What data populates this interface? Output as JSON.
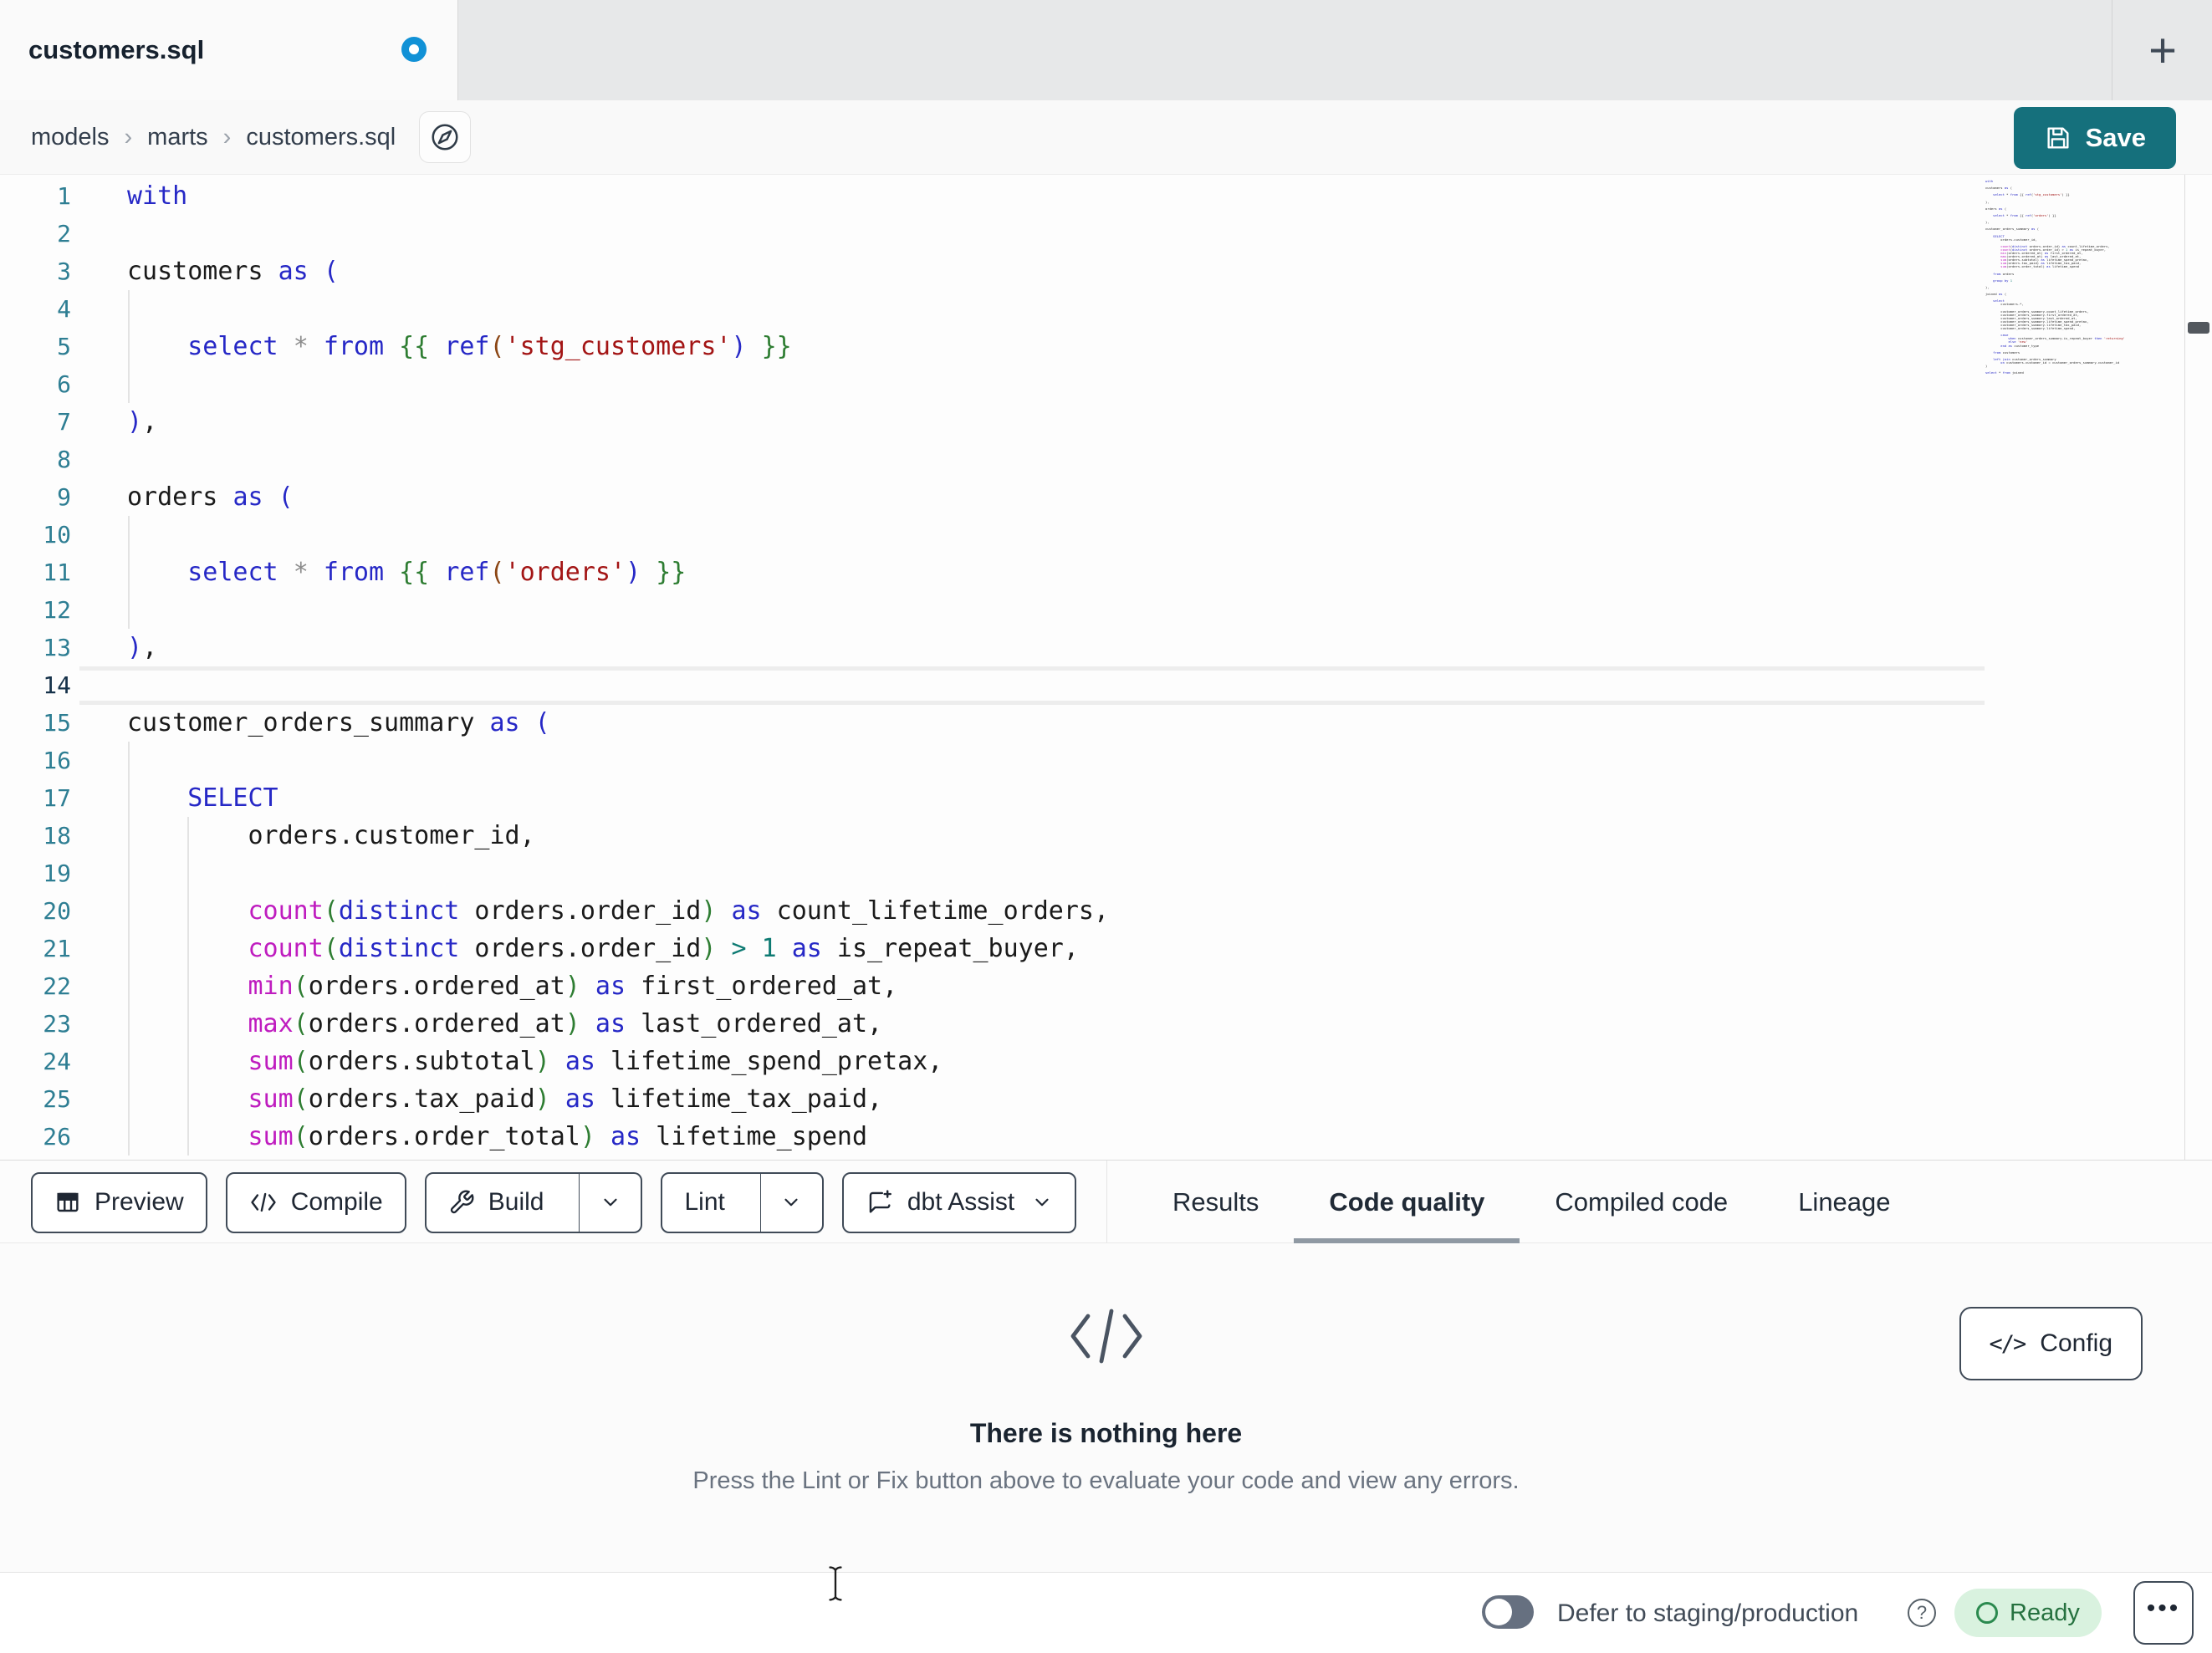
{
  "tab_bar": {
    "active_tab": "customers.sql",
    "unsaved_dot_color": "#1191d6",
    "new_tab_glyph": "+"
  },
  "breadcrumb": {
    "items": [
      "models",
      "marts",
      "customers.sql"
    ],
    "separator": "›"
  },
  "save_button": {
    "label": "Save",
    "color": "#15707c"
  },
  "editor": {
    "active_line": 14,
    "lines": [
      {
        "num": 1,
        "tokens": [
          [
            "with",
            "b"
          ]
        ]
      },
      {
        "num": 2,
        "tokens": []
      },
      {
        "num": 3,
        "tokens": [
          [
            "customers",
            "k"
          ],
          [
            " ",
            "k"
          ],
          [
            "as",
            "b"
          ],
          [
            " ",
            "k"
          ],
          [
            "(",
            "b"
          ]
        ]
      },
      {
        "num": 4,
        "tokens": []
      },
      {
        "num": 5,
        "tokens": [
          [
            "    ",
            "k"
          ],
          [
            "select",
            "b"
          ],
          [
            " ",
            "k"
          ],
          [
            "*",
            "y"
          ],
          [
            " ",
            "k"
          ],
          [
            "from",
            "b"
          ],
          [
            " ",
            "k"
          ],
          [
            "{{",
            "g"
          ],
          [
            " ",
            "k"
          ],
          [
            "ref",
            "b"
          ],
          [
            "(",
            "n"
          ],
          [
            "'stg_customers'",
            "r"
          ],
          [
            ")",
            "b"
          ],
          [
            " ",
            "k"
          ],
          [
            "}}",
            "g"
          ]
        ]
      },
      {
        "num": 6,
        "tokens": []
      },
      {
        "num": 7,
        "tokens": [
          [
            ")",
            "b"
          ],
          [
            ",",
            "k"
          ]
        ]
      },
      {
        "num": 8,
        "tokens": []
      },
      {
        "num": 9,
        "tokens": [
          [
            "orders",
            "k"
          ],
          [
            " ",
            "k"
          ],
          [
            "as",
            "b"
          ],
          [
            " ",
            "k"
          ],
          [
            "(",
            "b"
          ]
        ]
      },
      {
        "num": 10,
        "tokens": []
      },
      {
        "num": 11,
        "tokens": [
          [
            "    ",
            "k"
          ],
          [
            "select",
            "b"
          ],
          [
            " ",
            "k"
          ],
          [
            "*",
            "y"
          ],
          [
            " ",
            "k"
          ],
          [
            "from",
            "b"
          ],
          [
            " ",
            "k"
          ],
          [
            "{{",
            "g"
          ],
          [
            " ",
            "k"
          ],
          [
            "ref",
            "b"
          ],
          [
            "(",
            "n"
          ],
          [
            "'orders'",
            "r"
          ],
          [
            ")",
            "b"
          ],
          [
            " ",
            "k"
          ],
          [
            "}}",
            "g"
          ]
        ]
      },
      {
        "num": 12,
        "tokens": []
      },
      {
        "num": 13,
        "tokens": [
          [
            ")",
            "b"
          ],
          [
            ",",
            "k"
          ]
        ]
      },
      {
        "num": 14,
        "tokens": []
      },
      {
        "num": 15,
        "tokens": [
          [
            "customer_orders_summary",
            "k"
          ],
          [
            " ",
            "k"
          ],
          [
            "as",
            "b"
          ],
          [
            " ",
            "k"
          ],
          [
            "(",
            "b"
          ]
        ]
      },
      {
        "num": 16,
        "tokens": []
      },
      {
        "num": 17,
        "tokens": [
          [
            "    ",
            "k"
          ],
          [
            "SELECT",
            "b"
          ]
        ]
      },
      {
        "num": 18,
        "tokens": [
          [
            "        orders.customer_id,",
            "k"
          ]
        ]
      },
      {
        "num": 19,
        "tokens": []
      },
      {
        "num": 20,
        "tokens": [
          [
            "        ",
            "k"
          ],
          [
            "count",
            "m"
          ],
          [
            "(",
            "g"
          ],
          [
            "distinct",
            "b"
          ],
          [
            " orders.order_id",
            "k"
          ],
          [
            ")",
            "g"
          ],
          [
            " ",
            "k"
          ],
          [
            "as",
            "b"
          ],
          [
            " count_lifetime_orders,",
            "k"
          ]
        ]
      },
      {
        "num": 21,
        "tokens": [
          [
            "        ",
            "k"
          ],
          [
            "count",
            "m"
          ],
          [
            "(",
            "g"
          ],
          [
            "distinct",
            "b"
          ],
          [
            " orders.order_id",
            "k"
          ],
          [
            ")",
            "g"
          ],
          [
            " ",
            "k"
          ],
          [
            ">",
            "t"
          ],
          [
            " ",
            "k"
          ],
          [
            "1",
            "t"
          ],
          [
            " ",
            "k"
          ],
          [
            "as",
            "b"
          ],
          [
            " is_repeat_buyer,",
            "k"
          ]
        ]
      },
      {
        "num": 22,
        "tokens": [
          [
            "        ",
            "k"
          ],
          [
            "min",
            "m"
          ],
          [
            "(",
            "g"
          ],
          [
            "orders.ordered_at",
            "k"
          ],
          [
            ")",
            "g"
          ],
          [
            " ",
            "k"
          ],
          [
            "as",
            "b"
          ],
          [
            " first_ordered_at,",
            "k"
          ]
        ]
      },
      {
        "num": 23,
        "tokens": [
          [
            "        ",
            "k"
          ],
          [
            "max",
            "m"
          ],
          [
            "(",
            "g"
          ],
          [
            "orders.ordered_at",
            "k"
          ],
          [
            ")",
            "g"
          ],
          [
            " ",
            "k"
          ],
          [
            "as",
            "b"
          ],
          [
            " last_ordered_at,",
            "k"
          ]
        ]
      },
      {
        "num": 24,
        "tokens": [
          [
            "        ",
            "k"
          ],
          [
            "sum",
            "m"
          ],
          [
            "(",
            "g"
          ],
          [
            "orders.subtotal",
            "k"
          ],
          [
            ")",
            "g"
          ],
          [
            " ",
            "k"
          ],
          [
            "as",
            "b"
          ],
          [
            " lifetime_spend_pretax,",
            "k"
          ]
        ]
      },
      {
        "num": 25,
        "tokens": [
          [
            "        ",
            "k"
          ],
          [
            "sum",
            "m"
          ],
          [
            "(",
            "g"
          ],
          [
            "orders.tax_paid",
            "k"
          ],
          [
            ")",
            "g"
          ],
          [
            " ",
            "k"
          ],
          [
            "as",
            "b"
          ],
          [
            " lifetime_tax_paid,",
            "k"
          ]
        ]
      },
      {
        "num": 26,
        "tokens": [
          [
            "        ",
            "k"
          ],
          [
            "sum",
            "m"
          ],
          [
            "(",
            "g"
          ],
          [
            "orders.order_total",
            "k"
          ],
          [
            ")",
            "g"
          ],
          [
            " ",
            "k"
          ],
          [
            "as",
            "b"
          ],
          [
            " lifetime_spend",
            "k"
          ]
        ]
      }
    ]
  },
  "minimap": {
    "lines": [
      "with",
      "",
      "customers as (",
      "",
      "    select * from {{ ref('stg_customers') }}",
      "",
      "),",
      "",
      "orders as (",
      "",
      "    select * from {{ ref('orders') }}",
      "",
      "),",
      "",
      "customer_orders_summary as (",
      "",
      "    SELECT",
      "        orders.customer_id,",
      "",
      "        count(distinct orders.order_id) as count_lifetime_orders,",
      "        count(distinct orders.order_id) > 1 as is_repeat_buyer,",
      "        min(orders.ordered_at) as first_ordered_at,",
      "        max(orders.ordered_at) as last_ordered_at,",
      "        sum(orders.subtotal) as lifetime_spend_pretax,",
      "        sum(orders.tax_paid) as lifetime_tax_paid,",
      "        sum(orders.order_total) as lifetime_spend",
      "",
      "    from orders",
      "",
      "    group by 1",
      "",
      "),",
      "",
      "joined as (",
      "",
      "    select",
      "        customers.*,",
      "",
      "        customer_orders_summary.count_lifetime_orders,",
      "        customer_orders_summary.first_ordered_at,",
      "        customer_orders_summary.last_ordered_at,",
      "        customer_orders_summary.lifetime_spend_pretax,",
      "        customer_orders_summary.lifetime_tax_paid,",
      "        customer_orders_summary.lifetime_spend,",
      "",
      "        case",
      "            when customer_orders_summary.is_repeat_buyer then 'returning'",
      "            else 'new'",
      "        end as customer_type",
      "",
      "    from customers",
      "",
      "    left join customer_orders_summary",
      "        on customers.customer_id = customer_orders_summary.customer_id",
      ")",
      "",
      "select * from joined"
    ]
  },
  "toolbar": {
    "preview": "Preview",
    "compile": "Compile",
    "build": "Build",
    "lint": "Lint",
    "dbt_assist": "dbt Assist"
  },
  "panel_tabs": [
    {
      "label": "Results",
      "active": false
    },
    {
      "label": "Code quality",
      "active": true
    },
    {
      "label": "Compiled code",
      "active": false
    },
    {
      "label": "Lineage",
      "active": false
    }
  ],
  "empty_state": {
    "title": "There is nothing here",
    "subtitle": "Press the Lint or Fix button above to evaluate your code and view any errors."
  },
  "config_button": {
    "label": "Config",
    "glyph": "</>"
  },
  "status_bar": {
    "defer_label": "Defer to staging/production",
    "toggle_on": false,
    "ready_label": "Ready",
    "ready_bg": "#d9f2df",
    "ready_text_color": "#25713f"
  },
  "icons": {
    "new_tab_glyph": "+",
    "help_glyph": "?",
    "more_glyph": "•••",
    "compile_glyph": "</>",
    "save": "floppy-disk",
    "preview": "table-grid",
    "build": "wrench",
    "dbt_assist": "chat-bubble-plus",
    "breadcrumb_action": "compass",
    "empty_state": "code-brackets",
    "mouse": "text-ibeam"
  }
}
